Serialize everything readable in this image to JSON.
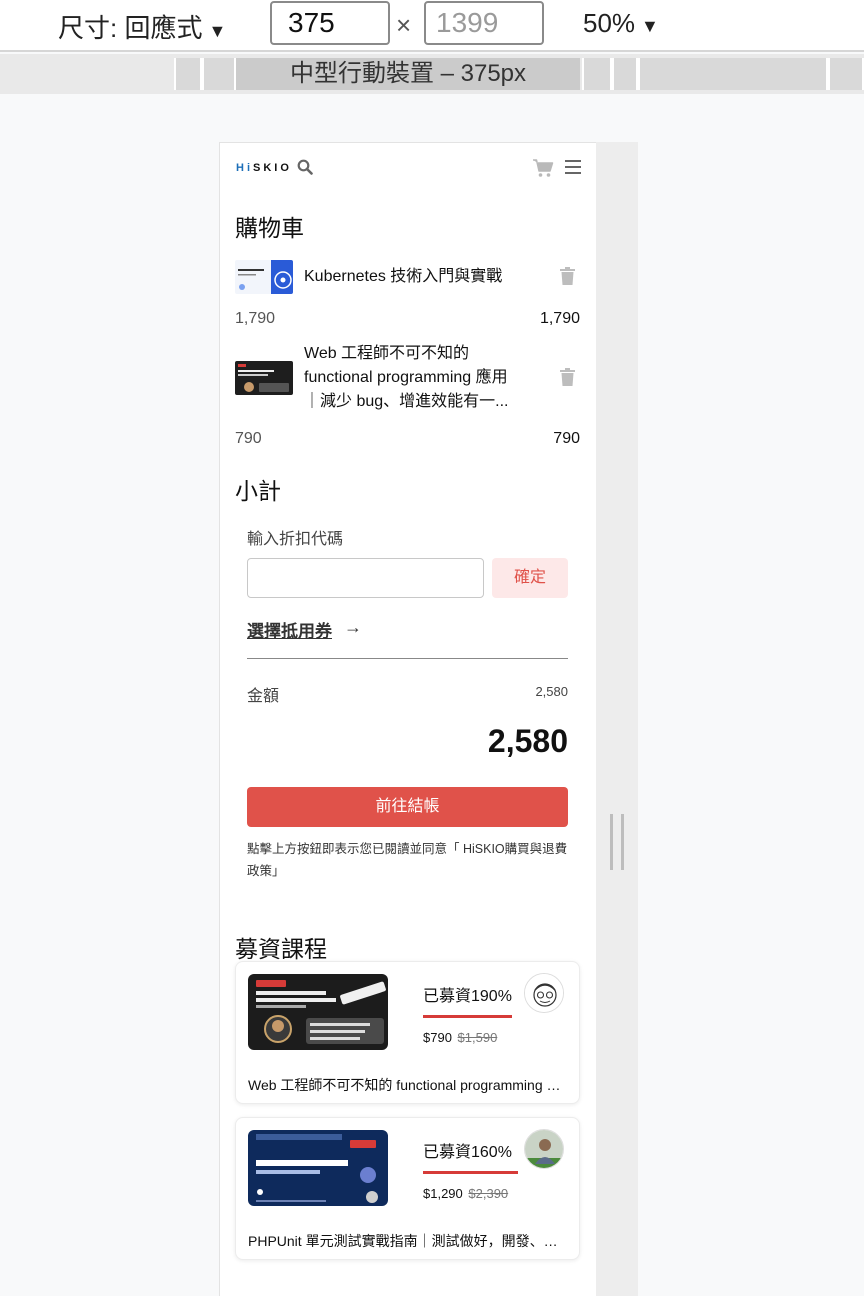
{
  "devtools": {
    "dimensions_label": "尺寸: 回應式",
    "width_value": "375",
    "height_placeholder": "1399",
    "times_symbol": "×",
    "zoom": "50%",
    "dropdown_symbol": "▼",
    "device_range_label": "中型行動裝置 – 375px"
  },
  "site": {
    "logo_hi": "Hi",
    "logo_rest": "SKIO"
  },
  "cart": {
    "title": "購物車",
    "items": [
      {
        "title": "Kubernetes 技術入門與實戰",
        "price_left": "1,790",
        "price_right": "1,790"
      },
      {
        "title": "Web 工程師不可不知的 functional programming 應用｜減少 bug、增進效能有一...",
        "price_left": "790",
        "price_right": "790"
      }
    ]
  },
  "summary": {
    "title": "小計",
    "coupon_label": "輸入折扣代碼",
    "coupon_value": "",
    "confirm_label": "確定",
    "voucher_label": "選擇抵用券",
    "voucher_arrow": "→",
    "amount_label": "金額",
    "amount_value": "2,580",
    "total": "2,580",
    "checkout_label": "前往結帳",
    "terms": "點擊上方按鈕即表示您已閱讀並同意「 HiSKIO購買與退費政策」"
  },
  "crowdfunding": {
    "title": "募資課程",
    "courses": [
      {
        "percent_label": "已募資190%",
        "percent": 190,
        "price": "$790",
        "original_price": "$1,590",
        "title": "Web 工程師不可不知的 functional programming 應用｜減少 bug、增進效能有一套"
      },
      {
        "percent_label": "已募資160%",
        "percent": 160,
        "price": "$1,290",
        "original_price": "$2,390",
        "title": "PHPUnit 單元測試實戰指南｜測試做好，開發、維護都安心"
      }
    ]
  },
  "colors": {
    "accent": "#e0524a",
    "progress": "#d63b38",
    "logo_blue": "#1d6fb8"
  }
}
